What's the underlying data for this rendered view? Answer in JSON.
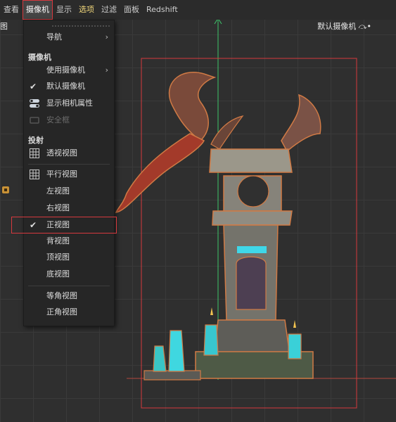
{
  "menubar": {
    "items": [
      "查看",
      "摄像机",
      "显示",
      "选项",
      "过滤",
      "面板",
      "Redshift"
    ],
    "active_index": 1,
    "highlight_index": 3
  },
  "viewport": {
    "camera_label": "默认摄像机 ⤼•",
    "left_stub_text": "图"
  },
  "dropdown": {
    "nav_label": "导航",
    "camera_header": "摄像机",
    "use_camera_label": "使用摄像机",
    "default_camera_label": "默认摄像机",
    "show_camera_props_label": "显示相机属性",
    "safe_frame_label": "安全框",
    "projection_header": "投射",
    "perspective_label": "透视视图",
    "parallel_label": "平行视图",
    "left_view_label": "左视图",
    "right_view_label": "右视图",
    "front_view_label": "正视图",
    "back_view_label": "背视图",
    "top_view_label": "顶视图",
    "bottom_view_label": "底视图",
    "iso_label": "等角视图",
    "ortho_label": "正角视图"
  },
  "colors": {
    "selection_red": "#d6393e",
    "axis_green": "#3ec46a",
    "accent_yellow": "#f0d67a"
  },
  "icons": {
    "submenu": "chevron-right-icon",
    "checked": "checkmark-icon",
    "grid": "grid-icon",
    "toggle": "toggle-icon"
  }
}
